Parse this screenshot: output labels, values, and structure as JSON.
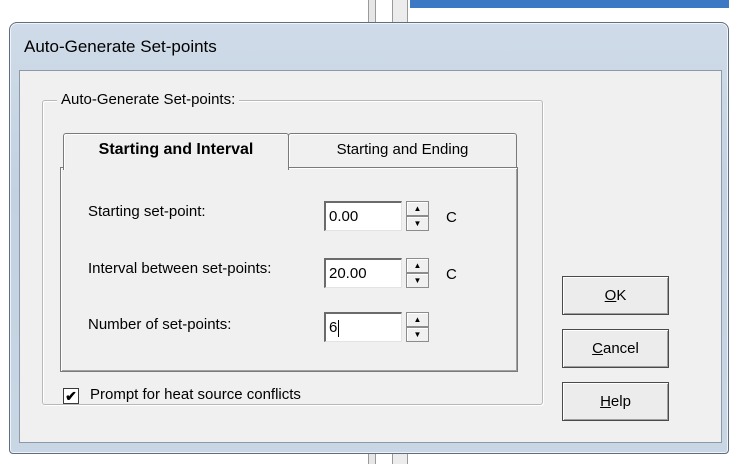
{
  "window": {
    "title": "Auto-Generate Set-points"
  },
  "group": {
    "legend": "Auto-Generate Set-points:"
  },
  "tabs": [
    {
      "label": "Starting and Interval",
      "active": true
    },
    {
      "label": "Starting and Ending",
      "active": false
    }
  ],
  "fields": {
    "starting": {
      "label": "Starting set-point:",
      "value": "0.00",
      "unit": "C"
    },
    "interval": {
      "label": "Interval between set-points:",
      "value": "20.00",
      "unit": "C"
    },
    "count": {
      "label": "Number of set-points:",
      "value": "6"
    }
  },
  "checkbox": {
    "label": "Prompt for heat source conflicts",
    "checked": true,
    "mark": "✔"
  },
  "buttons": {
    "ok": {
      "mnemonic": "O",
      "rest": "K"
    },
    "cancel": {
      "mnemonic": "C",
      "rest": "ancel"
    },
    "help": {
      "mnemonic": "H",
      "rest": "elp"
    }
  },
  "spin_glyphs": {
    "up": "▲",
    "down": "▼"
  }
}
